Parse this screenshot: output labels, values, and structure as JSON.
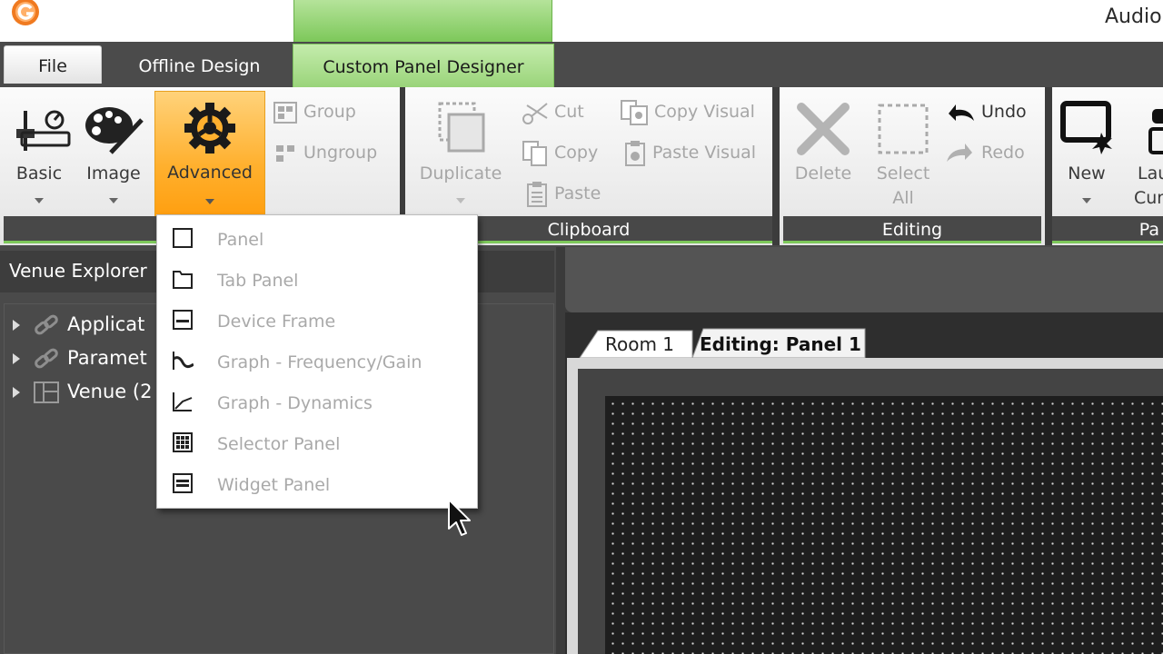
{
  "window": {
    "title": "Audio"
  },
  "tabs": {
    "file": "File",
    "offline_design": "Offline Design",
    "custom_panel_designer": "Custom Panel Designer"
  },
  "ribbon": {
    "insert": {
      "basic": "Basic",
      "image": "Image",
      "advanced": "Advanced",
      "group": "Group",
      "ungroup": "Ungroup"
    },
    "clipboard": {
      "label": "Clipboard",
      "duplicate": "Duplicate",
      "cut": "Cut",
      "copy": "Copy",
      "paste": "Paste",
      "copy_visual": "Copy Visual",
      "paste_visual": "Paste Visual"
    },
    "editing": {
      "label": "Editing",
      "delete": "Delete",
      "select_all_1": "Select",
      "select_all_2": "All",
      "undo": "Undo",
      "redo": "Redo"
    },
    "panel": {
      "label": "Pa",
      "new": "New",
      "launch_1": "Lau",
      "launch_2": "Cur"
    }
  },
  "advanced_menu": {
    "items": [
      {
        "label": "Panel",
        "icon": "panel-icon"
      },
      {
        "label": "Tab Panel",
        "icon": "tab-panel-icon"
      },
      {
        "label": "Device Frame",
        "icon": "device-frame-icon"
      },
      {
        "label": "Graph - Frequency/Gain",
        "icon": "graph-frequency-icon"
      },
      {
        "label": "Graph - Dynamics",
        "icon": "graph-dynamics-icon"
      },
      {
        "label": "Selector Panel",
        "icon": "selector-panel-icon"
      },
      {
        "label": "Widget Panel",
        "icon": "widget-panel-icon"
      }
    ]
  },
  "venue_explorer": {
    "title": "Venue Explorer",
    "items": [
      {
        "label": "Applicat"
      },
      {
        "label": "Paramet"
      },
      {
        "label": "Venue (2"
      }
    ]
  },
  "documents": {
    "tabs": [
      {
        "label": "Room 1"
      },
      {
        "label": "Editing: Panel 1"
      }
    ]
  },
  "colors": {
    "accent_green": "#7dc85a",
    "advanced_orange": "#ffb02e",
    "background_dark": "#4a4a4a"
  }
}
